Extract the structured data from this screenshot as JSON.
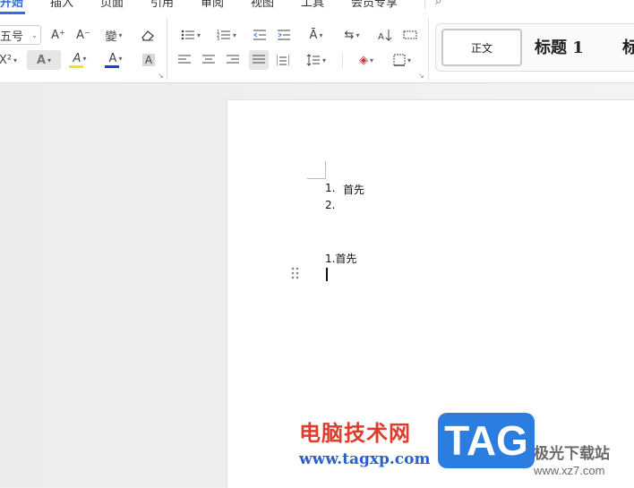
{
  "tabs": [
    {
      "label": "开始",
      "active": true
    },
    {
      "label": "插入"
    },
    {
      "label": "页面"
    },
    {
      "label": "引用"
    },
    {
      "label": "审阅"
    },
    {
      "label": "视图"
    },
    {
      "label": "工具"
    },
    {
      "label": "会员专享"
    }
  ],
  "ribbon": {
    "font_size": "五号",
    "grow_font": "A⁺",
    "shrink_font": "A⁻",
    "phonetic": "變",
    "superscript": "X²",
    "text_effect": "A",
    "highlight": "A",
    "font_color": "A",
    "char_shading": "A",
    "highlight_color": "#f5e600",
    "font_color_bar": "#1d3fd8"
  },
  "styles": {
    "normal": "正文",
    "heading1": "标题 1",
    "heading2": "标"
  },
  "document": {
    "list1_num1": "1.",
    "list1_item1": "首先",
    "list1_num2": "2.",
    "list2_item1": "1.首先"
  },
  "watermark": {
    "line1": "电脑技术网",
    "line2": "www.tagxp.com",
    "tag": "TAG",
    "line3": "极光下载站",
    "line4": "www.xz7.com"
  }
}
